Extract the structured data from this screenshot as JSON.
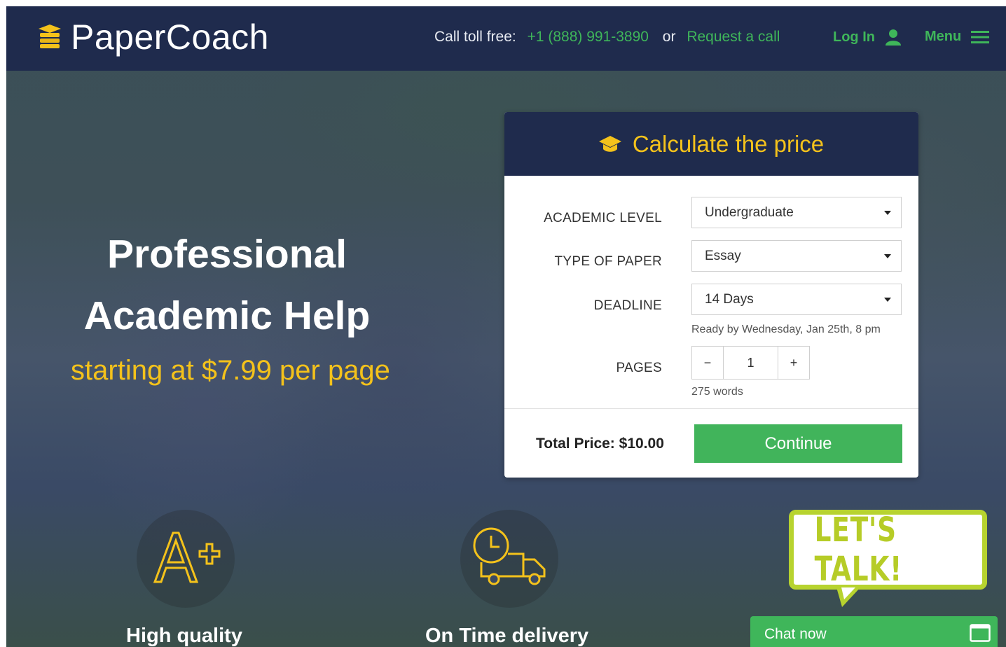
{
  "header": {
    "logo_text": "PaperCoach",
    "call_label": "Call toll free:",
    "phone": "+1 (888) 991-3890",
    "or": "or",
    "request_call": "Request a call",
    "login": "Log In",
    "menu": "Menu"
  },
  "hero": {
    "title_line1": "Professional",
    "title_line2": "Academic Help",
    "subtitle": "starting at $7.99 per page"
  },
  "calculator": {
    "title": "Calculate the price",
    "academic_level_label": "ACADEMIC LEVEL",
    "academic_level_value": "Undergraduate",
    "paper_type_label": "TYPE OF PAPER",
    "paper_type_value": "Essay",
    "deadline_label": "DEADLINE",
    "deadline_value": "14 Days",
    "deadline_hint": "Ready by Wednesday, Jan 25th, 8 pm",
    "pages_label": "PAGES",
    "pages_minus": "−",
    "pages_value": "1",
    "pages_plus": "+",
    "words_hint": "275 words",
    "total_price": "Total Price: $10.00",
    "continue_label": "Continue"
  },
  "features": [
    {
      "label": "High quality",
      "icon": "a-plus-icon"
    },
    {
      "label": "On Time delivery",
      "icon": "delivery-truck-clock-icon"
    }
  ],
  "chat": {
    "bubble_text": "LET'S TALK!",
    "chat_now": "Chat now"
  },
  "colors": {
    "navy": "#1f2b4d",
    "green": "#41b45b",
    "yellow": "#f4c21b",
    "lime": "#b7d32f"
  }
}
